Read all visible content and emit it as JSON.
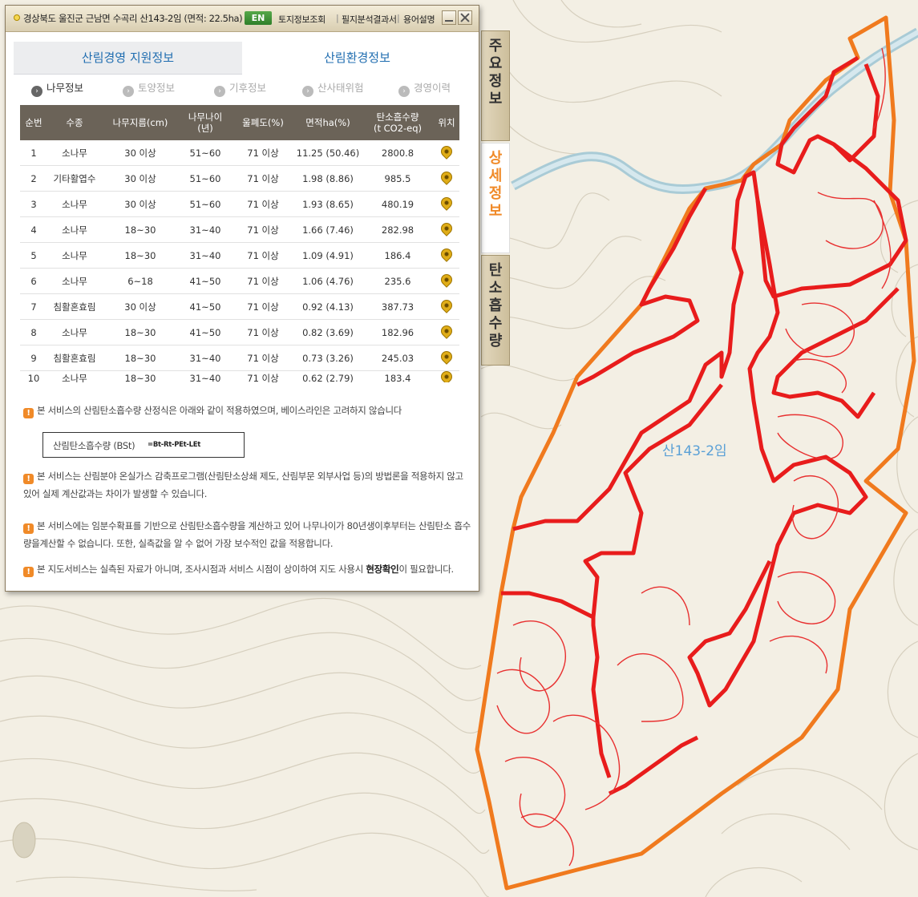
{
  "window": {
    "title": "경상북도 울진군 근남면 수곡리 산143-2임 (면적: 22.5ha)",
    "en_button": "EN",
    "links": [
      "토지정보조회",
      "필지분석결과서",
      "용어설명"
    ]
  },
  "main_tabs": [
    "산림경영 지원정보",
    "산림환경정보"
  ],
  "sub_tabs": [
    "나무정보",
    "토양정보",
    "기후정보",
    "산사태위험",
    "경영이력"
  ],
  "table": {
    "headers": [
      "순번",
      "수종",
      "나무지름(cm)",
      "나무나이\n(년)",
      "울폐도(%)",
      "면적ha(%)",
      "탄소흡수량\n(t CO2-eq)",
      "위치"
    ],
    "rows": [
      [
        "1",
        "소나무",
        "30 이상",
        "51~60",
        "71 이상",
        "11.25 (50.46)",
        "2800.8"
      ],
      [
        "2",
        "기타활엽수",
        "30 이상",
        "51~60",
        "71 이상",
        "1.98 (8.86)",
        "985.5"
      ],
      [
        "3",
        "소나무",
        "30 이상",
        "51~60",
        "71 이상",
        "1.93 (8.65)",
        "480.19"
      ],
      [
        "4",
        "소나무",
        "18~30",
        "31~40",
        "71 이상",
        "1.66 (7.46)",
        "282.98"
      ],
      [
        "5",
        "소나무",
        "18~30",
        "31~40",
        "71 이상",
        "1.09 (4.91)",
        "186.4"
      ],
      [
        "6",
        "소나무",
        "6~18",
        "41~50",
        "71 이상",
        "1.06 (4.76)",
        "235.6"
      ],
      [
        "7",
        "침활혼효림",
        "30 이상",
        "41~50",
        "71 이상",
        "0.92 (4.13)",
        "387.73"
      ],
      [
        "8",
        "소나무",
        "18~30",
        "41~50",
        "71 이상",
        "0.82 (3.69)",
        "182.96"
      ],
      [
        "9",
        "침활혼효림",
        "18~30",
        "31~40",
        "71 이상",
        "0.73 (3.26)",
        "245.03"
      ],
      [
        "10",
        "소나무",
        "18~30",
        "31~40",
        "71 이상",
        "0.62 (2.79)",
        "183.4"
      ]
    ]
  },
  "notes": {
    "note1": "본 서비스의 산림탄소흡수량 산정식은 아래와 같이 적용하였으며, 베이스라인은 고려하지 않습니다",
    "formula_label": "산림탄소흡수량 (BSt)",
    "formula": "=Bt-Rt-PEt-LEt",
    "note2": "본 서비스는 산림분야 온실가스 감축프로그램(산림탄소상쇄 제도, 산림부문 외부사업 등)의 방법론을 적용하지 않고 있어 실제 계산값과는 차이가 발생할 수 있습니다.",
    "note3": "본 서비스에는 임분수확표를 기반으로 산림탄소흡수량을 계산하고 있어 나무나이가 80년생이후부터는 산림탄소 흡수량을계산할 수 없습니다. 또한, 실측값을 알 수 없어 가장 보수적인 값을 적용합니다.",
    "note4_pre": "본 지도서비스는 실측된 자료가 아니며, 조사시점과 서비스 시점이 상이하여 지도 사용시 ",
    "note4_bold": "현장확인",
    "note4_post": "이 필요합니다."
  },
  "side_tabs": [
    "주요정보",
    "상세정보",
    "탄소흡수량"
  ],
  "map": {
    "parcel_label": "산143-2임",
    "colors": {
      "parcel_outline": "#f07a1e",
      "stand_boundary": "#e81c1c",
      "river": "#a9cbd6",
      "background": "#f3efe4"
    }
  }
}
